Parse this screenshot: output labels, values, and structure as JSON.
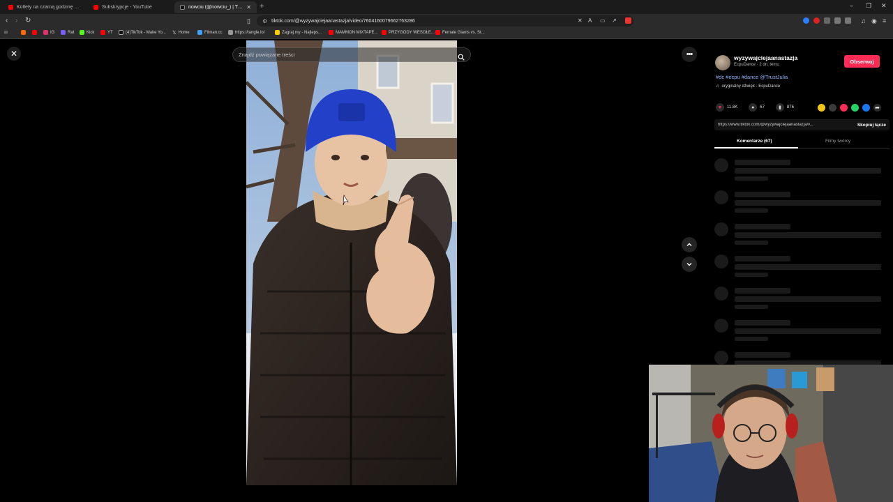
{
  "browser": {
    "tabs": [
      {
        "title": "Kotlety na czarną godzinę - mogą st...",
        "color": "#ff0000"
      },
      {
        "title": "Subskrypcje - YouTube",
        "color": "#ff0000"
      },
      {
        "title": "nowciu (@nowciu_) | TikTok",
        "color": "#ffffff"
      }
    ],
    "url": "tiktok.com/@wyzywajciejaanastazja/video/7604160079662763286",
    "bookmarks": [
      {
        "label": "IG",
        "color": "#e1306c"
      },
      {
        "label": "Rat",
        "color": "#7b5cff"
      },
      {
        "label": "Kick",
        "color": "#53fc18"
      },
      {
        "label": "YT",
        "color": "#ff0000"
      },
      {
        "label": "(4)TikTok - Make Yo...",
        "color": "#ffffff"
      },
      {
        "label": "Home",
        "color": "#ffffff"
      },
      {
        "label": "Filman.cc",
        "color": "#3fa0ff"
      },
      {
        "label": "https://tangle.io/",
        "color": "#999999"
      },
      {
        "label": "Zagraj.my - Najleps...",
        "color": "#ffcc00"
      },
      {
        "label": "MAMMON MIXTAPE...",
        "color": "#ff0000"
      },
      {
        "label": "PRZYGODY WESOŁE...",
        "color": "#ff0000"
      },
      {
        "label": "Female Giants vs. St...",
        "color": "#ff0000"
      }
    ]
  },
  "page": {
    "search_placeholder": "Znajdź powiązane treści"
  },
  "creator": {
    "username": "wyzywajciejaanastazja",
    "meta": "EcpuDance · 2 dn. temu",
    "follow_label": "Obserwuj",
    "hashtags": "#dc #ecpu #dance @TrustJulia",
    "sound": "oryginalny dźwięk - EcpuDance"
  },
  "stats": {
    "likes": "11.8K",
    "comments": "67",
    "saves": "876"
  },
  "share": {
    "link": "https://www.tiktok.com/@wyzywajciejaanastazja/v...",
    "copy_label": "Skopiuj łącze",
    "icon_colors": [
      "#f5c518",
      "#3a3a3a",
      "#fe2c55",
      "#25d366",
      "#1877f2",
      "#2a2a2a"
    ]
  },
  "comments_tabs": {
    "comments_label": "Komentarze (67)",
    "creator_videos_label": "Filmy twórcy"
  },
  "colors": {
    "accent": "#fe2c55",
    "hashtag": "#8fb4ff",
    "background": "#000000"
  }
}
